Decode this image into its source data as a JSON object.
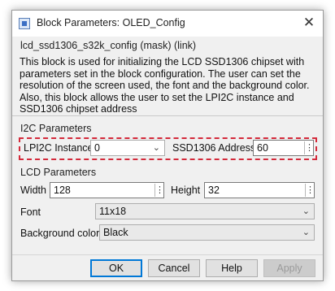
{
  "window": {
    "title": "Block Parameters: OLED_Config",
    "close_glyph": "✕"
  },
  "block": {
    "name": "lcd_ssd1306_s32k_config (mask) (link)",
    "description": "This block is used for initializing the LCD SSD1306 chipset with parameters set in the block configuration. The user can set the resolution of the screen used, the font and the background color. Also, this block allows the user to set the LPI2C instance and SSD1306 chipset address"
  },
  "i2c": {
    "title": "I2C Parameters",
    "instance_label": "LPI2C Instance",
    "instance_value": "0",
    "address_label": "SSD1306 Address",
    "address_value": "60"
  },
  "lcd": {
    "title": "LCD Parameters",
    "width_label": "Width",
    "width_value": "128",
    "height_label": "Height",
    "height_value": "32",
    "font_label": "Font",
    "font_value": "11x18",
    "bg_label": "Background color",
    "bg_value": "Black"
  },
  "icons": {
    "chevron": "⌄",
    "spin": "⋮"
  },
  "buttons": {
    "ok": "OK",
    "cancel": "Cancel",
    "help": "Help",
    "apply": "Apply"
  },
  "colors": {
    "highlight": "#d42a3b",
    "default_button_border": "#0078d7"
  }
}
